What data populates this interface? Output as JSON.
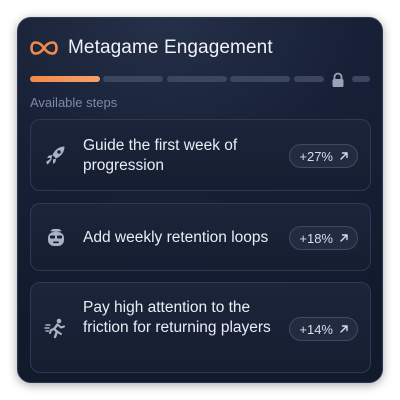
{
  "header": {
    "icon": "infinity-icon",
    "title": "Metagame Engagement",
    "accent_color": "#f08a4b"
  },
  "progress": {
    "segments_total": 6,
    "segments_completed": 1,
    "locked_icon": "lock-icon"
  },
  "section_label": "Available steps",
  "steps": [
    {
      "icon": "rocket-icon",
      "text": "Guide the first week of progression",
      "badge": "+27%",
      "badge_icon": "arrow-up-right-icon"
    },
    {
      "icon": "robot-face-icon",
      "text": "Add weekly retention loops",
      "badge": "+18%",
      "badge_icon": "arrow-up-right-icon"
    },
    {
      "icon": "running-person-icon",
      "text": "Pay high attention to the friction for returning players",
      "badge": "+14%",
      "badge_icon": "arrow-up-right-icon"
    }
  ]
}
